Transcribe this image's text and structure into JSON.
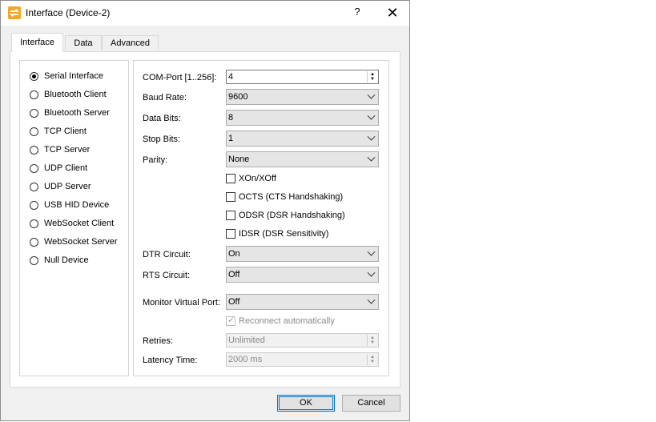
{
  "window": {
    "title": "Interface (Device-2)",
    "help_label": "?",
    "close_label": "✕",
    "icon_name": "swap-arrows-icon",
    "icon_color": "#f5a623"
  },
  "tabs": [
    {
      "label": "Interface",
      "active": true
    },
    {
      "label": "Data",
      "active": false
    },
    {
      "label": "Advanced",
      "active": false
    }
  ],
  "interface_types": [
    {
      "label": "Serial Interface",
      "checked": true
    },
    {
      "label": "Bluetooth Client",
      "checked": false
    },
    {
      "label": "Bluetooth Server",
      "checked": false
    },
    {
      "label": "TCP Client",
      "checked": false
    },
    {
      "label": "TCP Server",
      "checked": false
    },
    {
      "label": "UDP Client",
      "checked": false
    },
    {
      "label": "UDP Server",
      "checked": false
    },
    {
      "label": "USB HID Device",
      "checked": false
    },
    {
      "label": "WebSocket Client",
      "checked": false
    },
    {
      "label": "WebSocket Server",
      "checked": false
    },
    {
      "label": "Null Device",
      "checked": false
    }
  ],
  "settings": {
    "com_port": {
      "label": "COM-Port [1..256]:",
      "value": "4"
    },
    "baud_rate": {
      "label": "Baud Rate:",
      "value": "9600"
    },
    "data_bits": {
      "label": "Data Bits:",
      "value": "8"
    },
    "stop_bits": {
      "label": "Stop Bits:",
      "value": "1"
    },
    "parity": {
      "label": "Parity:",
      "value": "None"
    },
    "flow_control": [
      {
        "label": "XOn/XOff",
        "checked": false
      },
      {
        "label": "OCTS (CTS Handshaking)",
        "checked": false
      },
      {
        "label": "ODSR (DSR Handshaking)",
        "checked": false
      },
      {
        "label": "IDSR (DSR Sensitivity)",
        "checked": false
      }
    ],
    "dtr_circuit": {
      "label": "DTR Circuit:",
      "value": "On"
    },
    "rts_circuit": {
      "label": "RTS Circuit:",
      "value": "Off"
    },
    "monitor_port": {
      "label": "Monitor Virtual Port:",
      "value": "Off"
    },
    "reconnect": {
      "label": "Reconnect automatically",
      "checked": true,
      "disabled": true
    },
    "retries": {
      "label": "Retries:",
      "value": "Unlimited",
      "disabled": true
    },
    "latency": {
      "label": "Latency Time:",
      "value": "2000 ms",
      "disabled": true
    }
  },
  "buttons": {
    "ok": "OK",
    "cancel": "Cancel"
  }
}
